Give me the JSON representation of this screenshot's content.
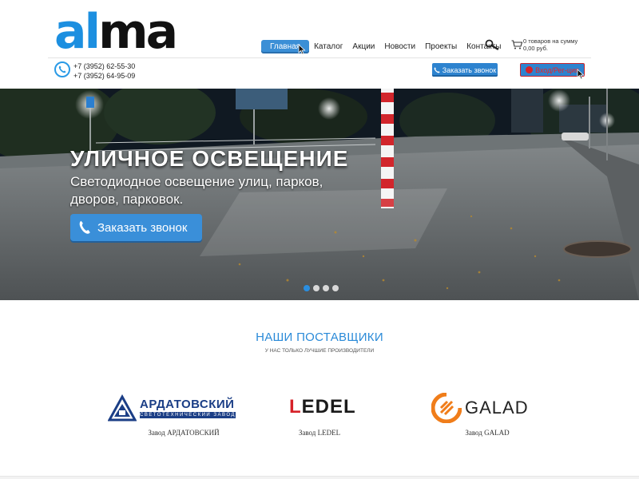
{
  "logo": {
    "part1": "al",
    "part2": "ma"
  },
  "nav": {
    "items": [
      {
        "label": "Главная",
        "active": true
      },
      {
        "label": "Каталог",
        "active": false
      },
      {
        "label": "Акции",
        "active": false
      },
      {
        "label": "Новости",
        "active": false
      },
      {
        "label": "Проекты",
        "active": false
      },
      {
        "label": "Контакты",
        "active": false
      }
    ]
  },
  "cart": {
    "line1": "0 товаров на сумму",
    "line2": "0,00 руб."
  },
  "contacts": {
    "phone1": "+7 (3952) 62-55-30",
    "phone2": "+7 (3952) 64-95-09"
  },
  "buttons": {
    "call_top": "Заказать звонок",
    "login": "Вход/Рег-ция"
  },
  "hero": {
    "title": "УЛИЧНОЕ ОСВЕЩЕНИЕ",
    "subtitle": "Светодиодное освещение улиц, парков, дворов, парковок.",
    "button": "Заказать звонок",
    "slides": 4,
    "active_slide": 1
  },
  "suppliers": {
    "title": "НАШИ ПОСТАВЩИКИ",
    "subtitle": "У НАС ТОЛЬКО ЛУЧШИЕ ПРОИЗВОДИТЕЛИ",
    "brands": [
      {
        "logo_text": "АРДАТОВСКИЙ",
        "logo_sub": "СВЕТОТЕХНИЧЕСКИЙ ЗАВОД",
        "caption": "Завод АРДАТОВСКИЙ"
      },
      {
        "logo_text": "LEDEL",
        "caption": "Завод LEDEL"
      },
      {
        "logo_text": "GALAD",
        "caption": "Завод GALAD"
      }
    ]
  },
  "colors": {
    "accent": "#2a8ee0",
    "button": "#2d83cf",
    "logo_blue": "#1c8fe0",
    "ledel_red": "#d62128",
    "galad_orange": "#f07d1a",
    "ardatov_blue": "#1b3e86"
  },
  "icons": [
    "phone-icon",
    "search-icon",
    "cart-icon",
    "login-icon"
  ]
}
